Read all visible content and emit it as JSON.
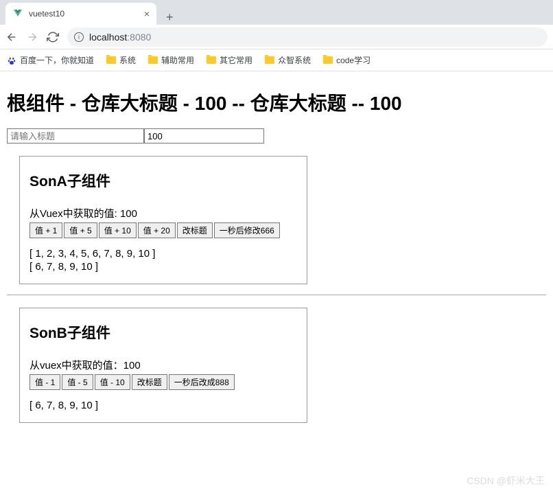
{
  "browser": {
    "tab_title": "vuetest10",
    "url_host": "localhost",
    "url_port": ":8080"
  },
  "bookmarks": {
    "baidu": "百度一下，你就知道",
    "items": [
      "系统",
      "辅助常用",
      "其它常用",
      "众智系统",
      "code学习"
    ]
  },
  "page": {
    "title": "根组件 - 仓库大标题 - 100 -- 仓库大标题 -- 100",
    "input1_placeholder": "请输入标题",
    "input2_value": "100"
  },
  "sonA": {
    "title": "SonA子组件",
    "info": "从Vuex中获取的值: 100",
    "buttons": [
      "值 + 1",
      "值 + 5",
      "值 + 10",
      "值 + 20",
      "改标题",
      "一秒后修改666"
    ],
    "array1": "[ 1, 2, 3, 4, 5, 6, 7, 8, 9, 10 ]",
    "array2": "[ 6, 7, 8, 9, 10 ]"
  },
  "sonB": {
    "title": "SonB子组件",
    "info": "从vuex中获取的值：100",
    "buttons": [
      "值 - 1",
      "值 - 5",
      "值 - 10",
      "改标题",
      "一秒后改成888"
    ],
    "array1": "[ 6, 7, 8, 9, 10 ]"
  },
  "watermark": "CSDN @虾米大王"
}
